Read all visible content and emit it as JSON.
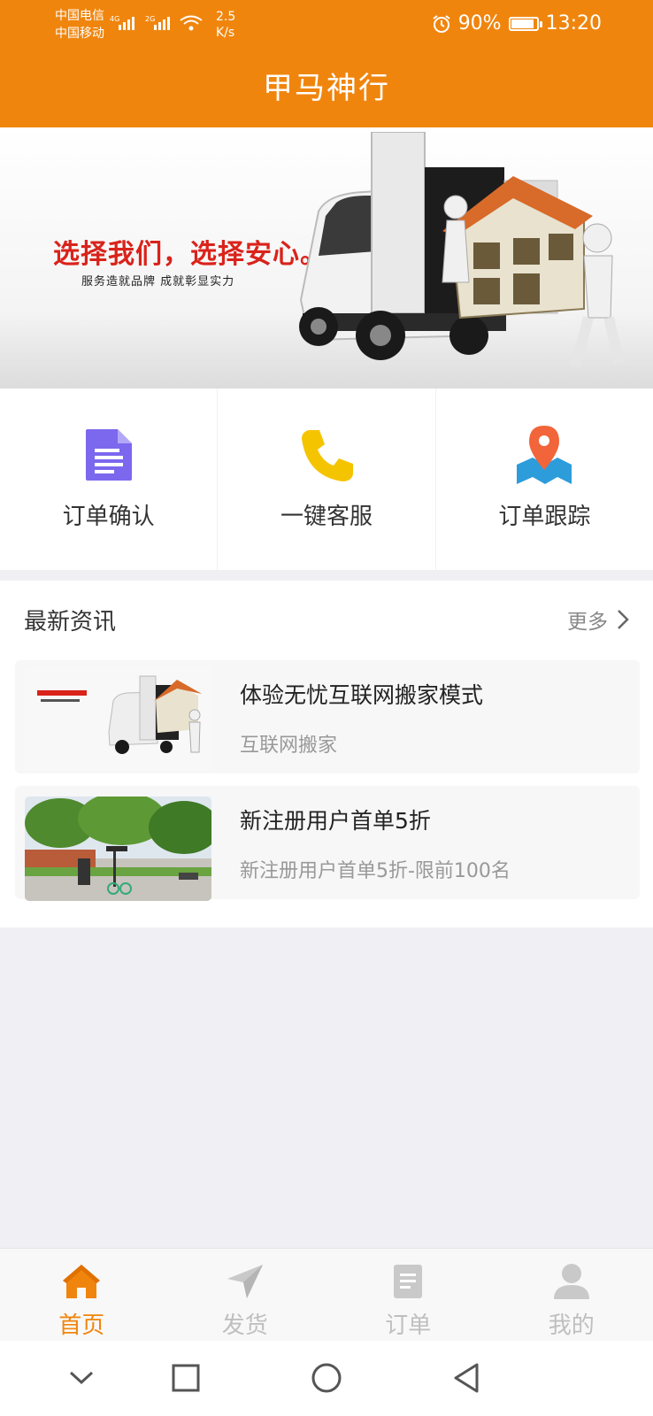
{
  "status_bar": {
    "carrier1": "中国电信",
    "carrier2": "中国移动",
    "net1": "4G",
    "net2": "2G",
    "speed_value": "2.5",
    "speed_unit": "K/s",
    "battery": "90%",
    "battery_level": 0.9,
    "time": "13:20"
  },
  "header": {
    "title": "甲马神行"
  },
  "banner": {
    "headline": "选择我们，选择安心。",
    "subline": "服务造就品牌 成就彰显实力"
  },
  "quick_actions": [
    {
      "label": "订单确认",
      "icon": "document-icon",
      "color": "#7b68ee"
    },
    {
      "label": "一键客服",
      "icon": "phone-icon",
      "color": "#f5c400"
    },
    {
      "label": "订单跟踪",
      "icon": "map-pin-icon",
      "color": "#f2643a"
    }
  ],
  "news": {
    "title": "最新资讯",
    "more": "更多",
    "items": [
      {
        "title": "体验无忧互联网搬家模式",
        "subtitle": "互联网搬家"
      },
      {
        "title": "新注册用户首单5折",
        "subtitle": "新注册用户首单5折-限前100名"
      }
    ]
  },
  "tabbar": {
    "active": "首页",
    "tabs": [
      {
        "label": "首页",
        "icon": "home-icon"
      },
      {
        "label": "发货",
        "icon": "send-icon"
      },
      {
        "label": "订单",
        "icon": "order-icon"
      },
      {
        "label": "我的",
        "icon": "user-icon"
      }
    ]
  },
  "colors": {
    "primary": "#f0850d",
    "background": "#efeff4",
    "inactive": "#bfbfbf"
  }
}
